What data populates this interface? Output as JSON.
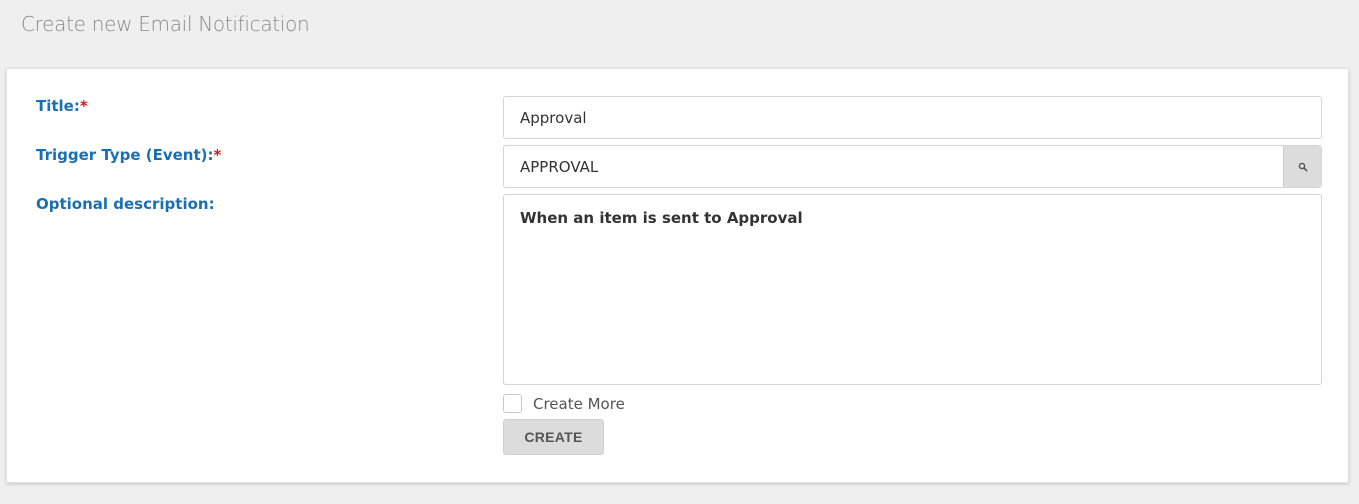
{
  "page": {
    "title": "Create new Email Notification"
  },
  "form": {
    "title_field": {
      "label": "Title",
      "colon": ":",
      "required_mark": "*",
      "value": "Approval"
    },
    "trigger_field": {
      "label": "Trigger Type (Event)",
      "colon": ":",
      "required_mark": "*",
      "value": "APPROVAL",
      "lookup_icon": "search-icon"
    },
    "description_field": {
      "label": "Optional description",
      "colon": ":",
      "value": "When an item is sent to Approval"
    },
    "create_more": {
      "label": "Create More",
      "checked": false
    },
    "create_button": {
      "label": "CREATE"
    }
  },
  "colors": {
    "label": "#1a6fb3",
    "required": "#d01a1a",
    "background": "#efefef",
    "button": "#dcdcdc"
  }
}
